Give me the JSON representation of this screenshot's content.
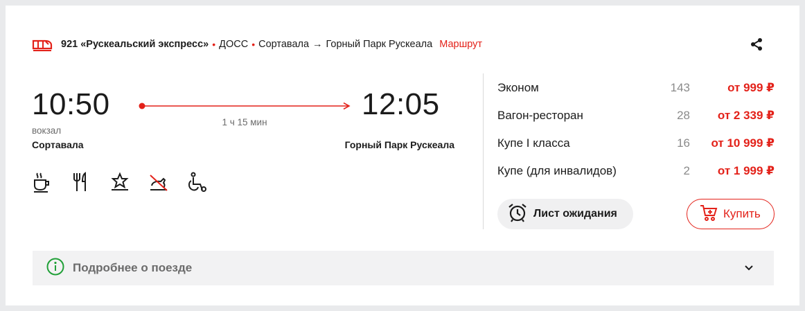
{
  "header": {
    "train_number_name": "921 «Рускеальский экспресс»",
    "separator": "•",
    "railway": "ДОСС",
    "from": "Сортавала",
    "arrow": "→",
    "to": "Горный Парк Рускеала",
    "route_link": "Маршрут"
  },
  "trip": {
    "departure_time": "10:50",
    "arrival_time": "12:05",
    "duration": "1 ч 15 мин",
    "departure_station_type": "вокзал",
    "departure_station": "Сортавала",
    "arrival_station": "Горный Парк Рускеала"
  },
  "amenities": [
    "coffee-icon",
    "restaurant-icon",
    "premium-icon",
    "no-pets-icon",
    "wheelchair-icon"
  ],
  "fares": [
    {
      "class": "Эконом",
      "seats": "143",
      "price": "от 999 ₽"
    },
    {
      "class": "Вагон-ресторан",
      "seats": "28",
      "price": "от 2 339 ₽"
    },
    {
      "class": "Купе I класса",
      "seats": "16",
      "price": "от 10 999 ₽"
    },
    {
      "class": "Купе (для инвалидов)",
      "seats": "2",
      "price": "от 1 999 ₽"
    }
  ],
  "actions": {
    "waitlist_label": "Лист ожидания",
    "buy_label": "Купить"
  },
  "details": {
    "label": "Подробнее о поезде"
  },
  "colors": {
    "accent": "#e32119",
    "info_green": "#21a038",
    "background": "#e9eaec"
  }
}
